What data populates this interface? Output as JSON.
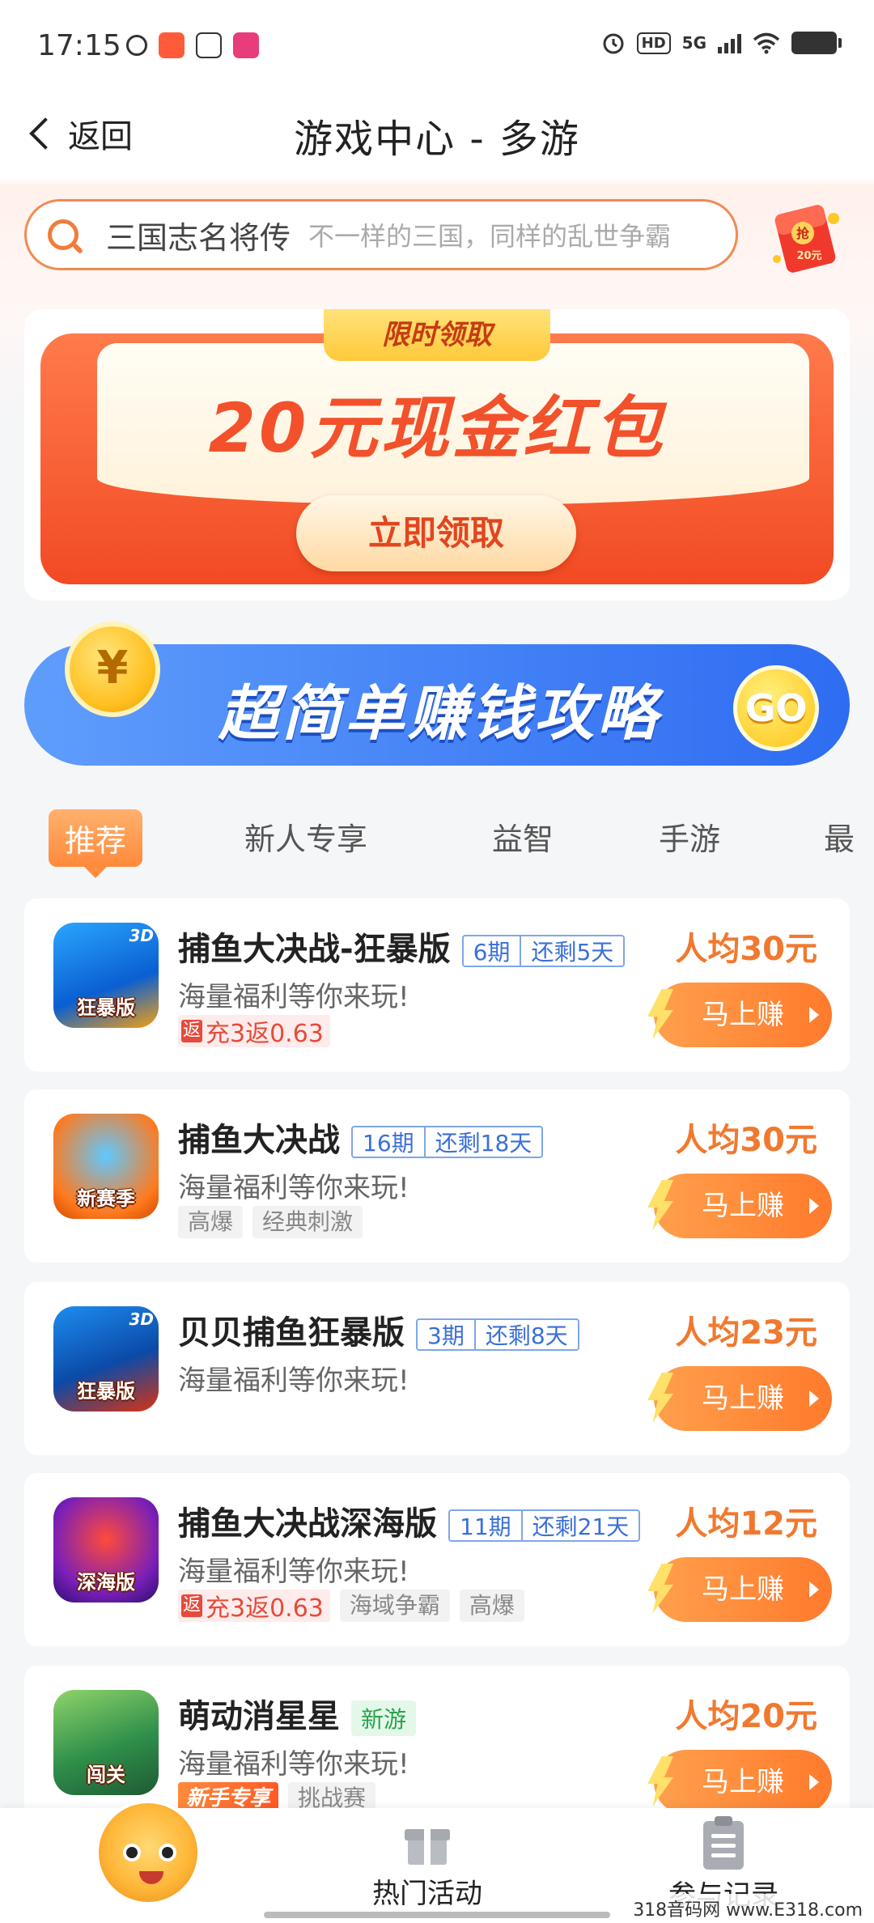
{
  "status_bar": {
    "time": "17:15",
    "network": "5G",
    "hd": "HD",
    "icons": [
      "alarm-icon",
      "wifi-icon",
      "battery-icon"
    ]
  },
  "header": {
    "back_label": "返回",
    "title": "游戏中心 - 多游"
  },
  "search": {
    "value": "三国志名将传",
    "placeholder": "不一样的三国，同样的乱世争霸"
  },
  "redpack_badge": {
    "top": "抢",
    "bottom": "20元"
  },
  "banner": {
    "tag": "限时领取",
    "headline": "20元现金红包",
    "cta": "立即领取"
  },
  "strategy": {
    "coin": "¥",
    "label": "超简单赚钱攻略",
    "go": "GO"
  },
  "tabs": [
    "推荐",
    "新人专享",
    "益智",
    "手游",
    "最"
  ],
  "games": [
    {
      "icon_badge": "狂暴版",
      "icon_3d": "3D",
      "title": "捕鱼大决战-狂暴版",
      "period": "6期",
      "remaining": "还剩5天",
      "desc": "海量福利等你来玩!",
      "rebate": "充3返0.63",
      "tags": [],
      "price": "人均30元",
      "button": "马上赚"
    },
    {
      "icon_badge": "新赛季",
      "icon_3d": "",
      "title": "捕鱼大决战",
      "period": "16期",
      "remaining": "还剩18天",
      "desc": "海量福利等你来玩!",
      "rebate": "",
      "tags": [
        "高爆",
        "经典刺激"
      ],
      "price": "人均30元",
      "button": "马上赚"
    },
    {
      "icon_badge": "狂暴版",
      "icon_3d": "3D",
      "title": "贝贝捕鱼狂暴版",
      "period": "3期",
      "remaining": "还剩8天",
      "desc": "海量福利等你来玩!",
      "rebate": "",
      "tags": [],
      "price": "人均23元",
      "button": "马上赚"
    },
    {
      "icon_badge": "深海版",
      "icon_3d": "",
      "title": "捕鱼大决战深海版",
      "period": "11期",
      "remaining": "还剩21天",
      "desc": "海量福利等你来玩!",
      "rebate": "充3返0.63",
      "tags": [
        "海域争霸",
        "高爆"
      ],
      "price": "人均12元",
      "button": "马上赚"
    },
    {
      "icon_badge": "闯关",
      "icon_3d": "",
      "title": "萌动消星星",
      "new_tag": "新游",
      "desc": "海量福利等你来玩!",
      "novice_tag": "新手专享",
      "tags": [
        "挑战赛"
      ],
      "price": "人均20元",
      "button": "马上赚"
    }
  ],
  "rebate_prefix": "返",
  "bottom_nav": {
    "activities": "热门活动",
    "records": "参与记录"
  },
  "watermark": "318音码网 www.E318.com",
  "colors": {
    "accent_orange": "#ff7a2c",
    "price_orange": "#f0792f",
    "period_blue": "#3a6fd8",
    "banner_red": "#f24a24",
    "strategy_blue": "#2e6cf2"
  }
}
